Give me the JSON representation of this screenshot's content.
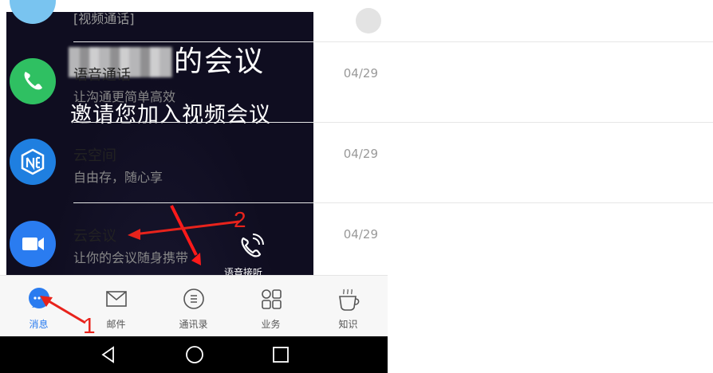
{
  "call_screen": {
    "title_suffix": "的会议",
    "invite_text": "邀请您加入视频会议",
    "voice_answer_label": "语音接听"
  },
  "chat_list": {
    "items": [
      {
        "title": "",
        "subtitle": "[视频通话]",
        "date": "",
        "icon": "video-call-icon",
        "color": "#79c4f0"
      },
      {
        "title": "语音通话",
        "subtitle": "让沟通更简单高效",
        "date": "04/29",
        "icon": "phone-icon",
        "color": "#2fc062"
      },
      {
        "title": "云空间",
        "subtitle": "自由存，随心享",
        "date": "04/29",
        "icon": "cloud-space-icon",
        "color": "#1f7fe0"
      },
      {
        "title": "云会议",
        "subtitle": "让你的会议随身携带",
        "date": "04/29",
        "icon": "video-camera-icon",
        "color": "#2a7cf0"
      }
    ]
  },
  "tabbar": {
    "tabs": [
      {
        "label": "消息",
        "icon": "chat-bubble-icon",
        "active": true
      },
      {
        "label": "邮件",
        "icon": "mail-icon",
        "active": false
      },
      {
        "label": "通讯录",
        "icon": "contacts-icon",
        "active": false
      },
      {
        "label": "业务",
        "icon": "apps-grid-icon",
        "active": false
      },
      {
        "label": "知识",
        "icon": "coffee-icon",
        "active": false
      }
    ]
  },
  "annotations": {
    "label_1": "1",
    "label_2": "2"
  },
  "colors": {
    "accent": "#2a7cf0",
    "annotation_red": "#e8231c",
    "decline": "#e8474b",
    "accept": "#62c06a"
  }
}
